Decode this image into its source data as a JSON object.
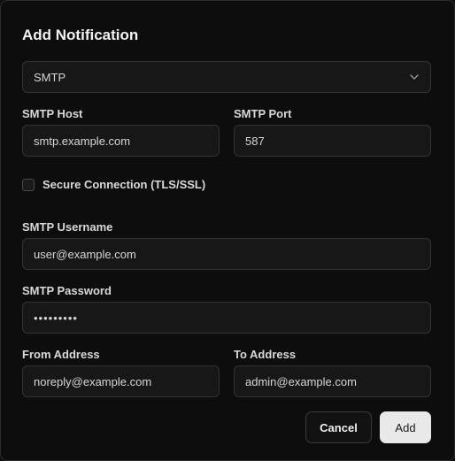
{
  "dialog": {
    "title": "Add Notification",
    "type_select": {
      "value": "SMTP"
    },
    "smtp_host": {
      "label": "SMTP Host",
      "value": "smtp.example.com"
    },
    "smtp_port": {
      "label": "SMTP Port",
      "value": "587"
    },
    "secure": {
      "label": "Secure Connection (TLS/SSL)",
      "checked": false
    },
    "smtp_username": {
      "label": "SMTP Username",
      "value": "user@example.com"
    },
    "smtp_password": {
      "label": "SMTP Password",
      "value": "•••••••••"
    },
    "from_address": {
      "label": "From Address",
      "value": "noreply@example.com"
    },
    "to_address": {
      "label": "To Address",
      "value": "admin@example.com"
    },
    "buttons": {
      "cancel": "Cancel",
      "add": "Add"
    }
  }
}
